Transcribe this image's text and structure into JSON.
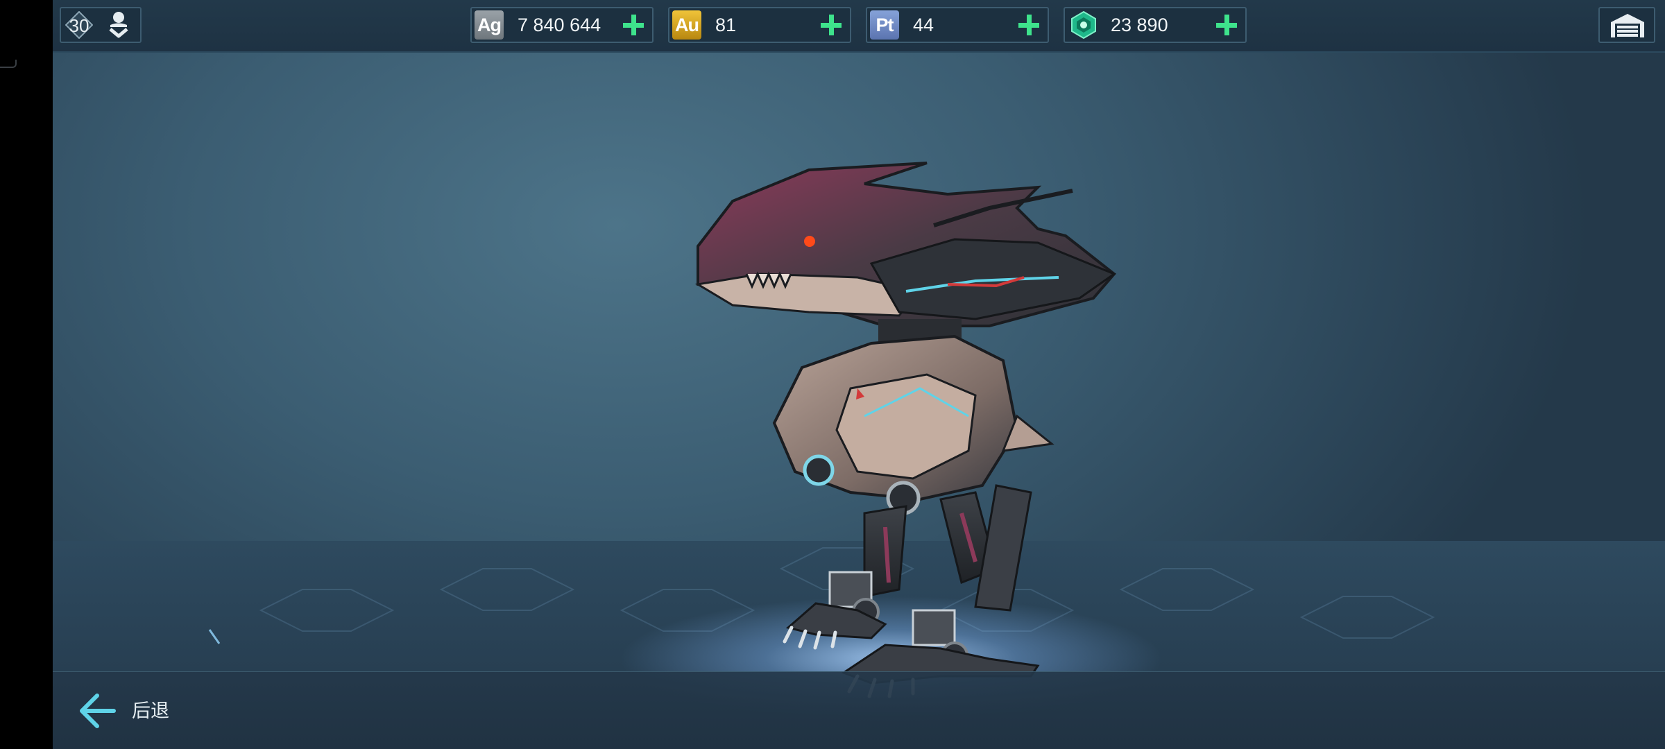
{
  "player": {
    "level": "30",
    "profile_icon": "profile-download-icon"
  },
  "currencies": [
    {
      "id": "ag",
      "badge": "Ag",
      "value": "7 840 644",
      "color": "#8a9298"
    },
    {
      "id": "au",
      "badge": "Au",
      "value": "81",
      "color": "#d9a520"
    },
    {
      "id": "pt",
      "badge": "Pt",
      "value": "44",
      "color": "#6f8cc8"
    },
    {
      "id": "gem",
      "badge": "",
      "value": "23 890",
      "color": "#2fd49a"
    }
  ],
  "garage": {
    "icon": "garage-icon"
  },
  "bottom": {
    "back_label": "后退",
    "back_icon": "arrow-left-icon"
  },
  "colors": {
    "accent_green": "#3ee38c",
    "accent_cyan": "#5fd3e8"
  }
}
